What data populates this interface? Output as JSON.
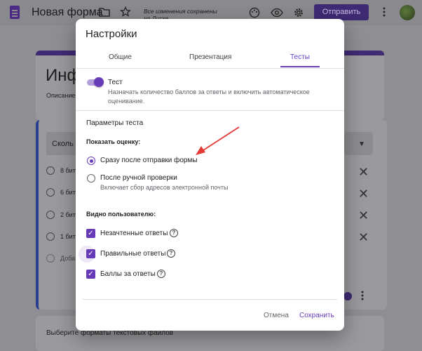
{
  "app": {
    "form_title": "Новая форма",
    "saved_line1": "Все изменения сохранены",
    "saved_line2": "на Диске",
    "send_button": "Отправить"
  },
  "background": {
    "form_heading": "Инф",
    "form_description": "Описание",
    "question_text": "Сколь",
    "options": [
      "8 бит",
      "6 бит",
      "2 бит",
      "1 бит"
    ],
    "add_option": "Доба",
    "bottom_text": "Выберите форматы текстовых файлов"
  },
  "dialog": {
    "title": "Настройки",
    "tabs": [
      {
        "label": "Общие",
        "active": false
      },
      {
        "label": "Презентация",
        "active": false
      },
      {
        "label": "Тесты",
        "active": true
      }
    ],
    "quiz_toggle": {
      "label": "Тест",
      "on": true,
      "description": "Назначать количество баллов за ответы и включить автоматическое оценивание."
    },
    "section_title": "Параметры теста",
    "release_grade": {
      "label": "Показать оценку:",
      "options": [
        {
          "label": "Сразу после отправки формы",
          "selected": true,
          "hint": ""
        },
        {
          "label": "После ручной проверки",
          "selected": false,
          "hint": "Включает сбор адресов электронной почты"
        }
      ]
    },
    "respondent_can_see": {
      "label": "Видно пользователю:",
      "options": [
        {
          "label": "Незачтенные ответы",
          "checked": true
        },
        {
          "label": "Правильные ответы",
          "checked": true
        },
        {
          "label": "Баллы за ответы",
          "checked": true
        }
      ]
    },
    "cancel_button": "Отмена",
    "save_button": "Сохранить"
  },
  "colors": {
    "accent": "#673ab7",
    "annotation_arrow": "#e53935"
  },
  "icons": [
    "docs-form-icon",
    "folder-icon",
    "star-icon",
    "palette-icon",
    "eye-icon",
    "gear-icon",
    "more-vert-icon",
    "close-icon",
    "chevron-down-icon",
    "help-icon",
    "check-icon"
  ]
}
